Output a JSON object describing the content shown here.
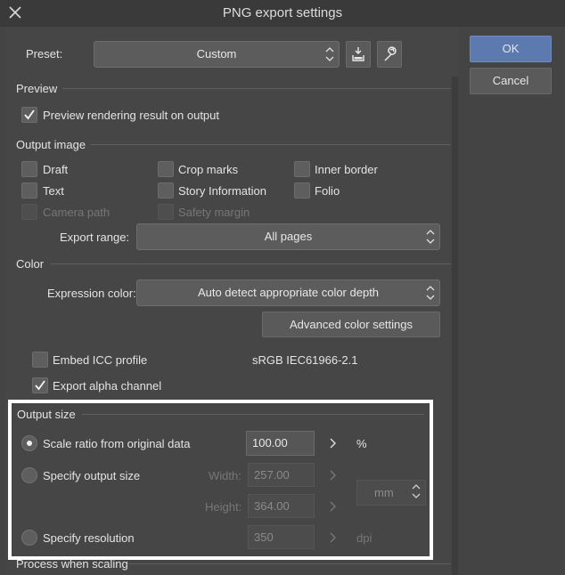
{
  "window": {
    "title": "PNG export settings"
  },
  "buttons": {
    "ok": "OK",
    "cancel": "Cancel"
  },
  "preset": {
    "label": "Preset:",
    "value": "Custom"
  },
  "preview": {
    "section": "Preview",
    "render_on_output": {
      "label": "Preview rendering result on output",
      "checked": true
    }
  },
  "output_image": {
    "section": "Output image",
    "options": [
      {
        "label": "Draft",
        "checked": false,
        "enabled": true
      },
      {
        "label": "Crop marks",
        "checked": false,
        "enabled": true
      },
      {
        "label": "Inner border",
        "checked": false,
        "enabled": true
      },
      {
        "label": "Text",
        "checked": false,
        "enabled": true
      },
      {
        "label": "Story Information",
        "checked": false,
        "enabled": true
      },
      {
        "label": "Folio",
        "checked": false,
        "enabled": true
      },
      {
        "label": "Camera path",
        "checked": false,
        "enabled": false
      },
      {
        "label": "Safety margin",
        "checked": false,
        "enabled": false
      }
    ],
    "export_range": {
      "label": "Export range:",
      "value": "All pages"
    }
  },
  "color": {
    "section": "Color",
    "expression": {
      "label": "Expression color:",
      "value": "Auto detect appropriate color depth"
    },
    "advanced_button": "Advanced color settings",
    "embed_icc": {
      "label": "Embed ICC profile",
      "checked": false,
      "profile": "sRGB IEC61966-2.1"
    },
    "export_alpha": {
      "label": "Export alpha channel",
      "checked": true
    }
  },
  "output_size": {
    "section": "Output size",
    "scale_ratio": {
      "label": "Scale ratio from original data",
      "selected": true,
      "value": "100.00",
      "unit": "%"
    },
    "specify_size": {
      "label": "Specify output size",
      "selected": false,
      "width_label": "Width:",
      "width": "257.00",
      "height_label": "Height:",
      "height": "364.00",
      "unit": "mm"
    },
    "specify_resolution": {
      "label": "Specify resolution",
      "selected": false,
      "value": "350",
      "unit": "dpi"
    }
  },
  "process_scaling": {
    "section": "Process when scaling"
  },
  "colors": {
    "background": "#444444",
    "ok_button": "#5d7ab0",
    "highlight_border": "#ffffff"
  }
}
